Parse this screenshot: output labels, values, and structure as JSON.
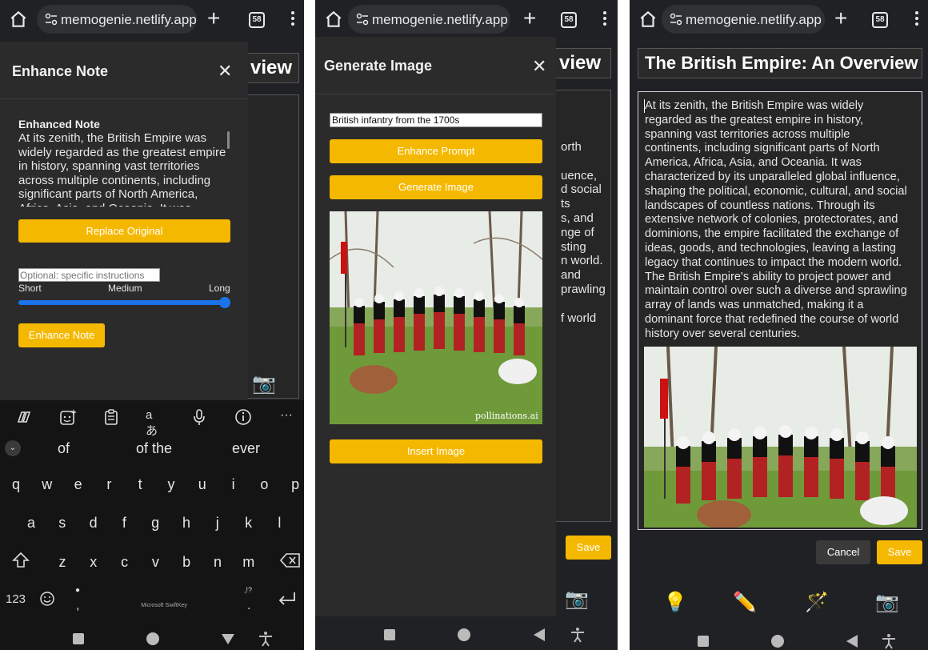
{
  "browser": {
    "url": "memogenie.netlify.app",
    "tab_count": "58"
  },
  "panel1": {
    "bg_title_fragment": "view",
    "modal": {
      "title": "Enhance Note",
      "enhanced_label": "Enhanced Note",
      "enhanced_lines": [
        "At its zenith, the British Empire was",
        "widely regarded as the greatest empire",
        "in history, spanning vast territories",
        "across multiple continents, including",
        "significant parts of North America,",
        "Africa, Asia, and Oceania. It was"
      ],
      "replace_label": "Replace Original",
      "instructions_placeholder": "Optional: specific instructions",
      "slider_labels": {
        "short": "Short",
        "medium": "Medium",
        "long": "Long"
      },
      "slider_value": 1.0,
      "enhance_label": "Enhance Note"
    },
    "keyboard": {
      "suggestions": [
        "of",
        "of the",
        "ever"
      ],
      "row1": [
        "q",
        "w",
        "e",
        "r",
        "t",
        "y",
        "u",
        "i",
        "o",
        "p"
      ],
      "row2": [
        "a",
        "s",
        "d",
        "f",
        "g",
        "h",
        "j",
        "k",
        "l"
      ],
      "row3": [
        "z",
        "x",
        "c",
        "v",
        "b",
        "n",
        "m"
      ],
      "num_key": "123",
      "brand": "Microsoft SwiftKey",
      "punct_hint": ",!?",
      "comma": ",",
      "period": "."
    }
  },
  "panel2": {
    "bg_title_fragment": "view",
    "bg_fragments": [
      "orth",
      "",
      "uence,",
      "d social",
      "ts",
      "s, and",
      "nge of",
      "sting",
      "n world.",
      "and",
      "prawling",
      "",
      "f world"
    ],
    "bg_save_label": "Save",
    "modal": {
      "title": "Generate Image",
      "prompt_value": "British infantry from the 1700s",
      "enhance_prompt_label": "Enhance Prompt",
      "generate_label": "Generate Image",
      "image_watermark": "pollinations.ai",
      "insert_label": "Insert Image"
    }
  },
  "panel3": {
    "title": "The British Empire: An Overview",
    "body_lines": [
      "At its zenith, the British Empire was widely",
      "regarded as the greatest empire in history,",
      "spanning vast territories across multiple",
      "continents, including significant parts of North",
      "America, Africa, Asia, and Oceania. It was",
      "characterized by its unparalleled global influence,",
      "shaping the political, economic, cultural, and social",
      "landscapes of countless nations. Through its",
      "extensive network of colonies, protectorates, and",
      "dominions, the empire facilitated the exchange of",
      "ideas, goods, and technologies, leaving a lasting",
      "legacy that continues to impact the modern world.",
      "The British Empire's ability to project power and",
      "maintain control over such a diverse and sprawling",
      "array of lands was unmatched, making it a",
      "dominant force that redefined the course of world",
      "history over several centuries."
    ],
    "cancel_label": "Cancel",
    "save_label": "Save",
    "toolbar_icons": [
      "lightbulb-icon",
      "pencil-icon",
      "magic-wand-icon",
      "camera-icon"
    ]
  },
  "colors": {
    "accent": "#f5b800",
    "slider": "#1a73e8",
    "background": "#202124",
    "modal": "#2b2b2b"
  }
}
